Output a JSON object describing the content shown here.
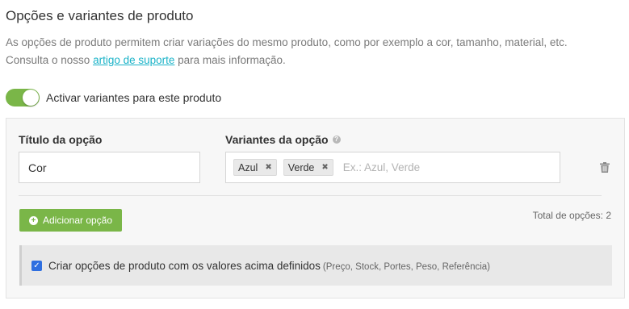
{
  "section": {
    "title": "Opções e variantes de produto",
    "description_line1": "As opções de produto permitem criar variações do mesmo produto, como por exemplo a cor, tamanho, material, etc.",
    "description_line2_prefix": "Consulta o nosso ",
    "support_link": "artigo de suporte",
    "description_line2_suffix": " para mais informação."
  },
  "toggle": {
    "label": "Activar variantes para este produto",
    "enabled": true,
    "color": "#7ab648"
  },
  "option": {
    "title_label": "Título da opção",
    "title_value": "Cor",
    "variants_label": "Variantes da opção",
    "help_icon": "help-icon",
    "variants": [
      {
        "label": "Azul"
      },
      {
        "label": "Verde"
      }
    ],
    "variants_placeholder": "Ex.: Azul, Verde",
    "remove_icon": "trash-icon"
  },
  "actions": {
    "add_option_label": "Adicionar opção",
    "add_icon": "plus-circle-icon",
    "total_options": "Total de opções: 2"
  },
  "create_options": {
    "checked": true,
    "label": "Criar opções de produto com os valores acima definidos",
    "hint": "(Preço, Stock, Portes, Peso, Referência)",
    "checkbox_color": "#2f6fe0"
  }
}
